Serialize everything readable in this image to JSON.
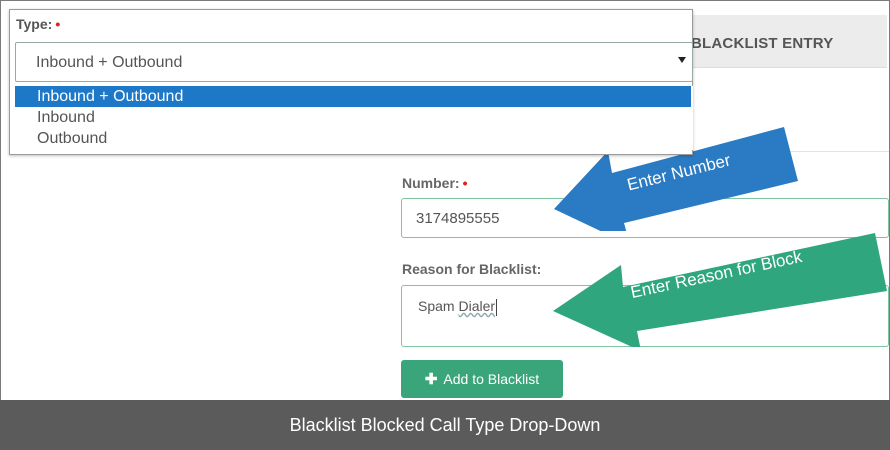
{
  "panel": {
    "header_title": "BLACKLIST ENTRY"
  },
  "type_field": {
    "label": "Type:",
    "required_marker": "•",
    "selected": "Inbound + Outbound",
    "options": [
      "Inbound + Outbound",
      "Inbound",
      "Outbound"
    ]
  },
  "number_field": {
    "label": "Number:",
    "required_marker": "•",
    "value": "3174895555"
  },
  "reason_field": {
    "label": "Reason for Blacklist:",
    "value_part1": "Spam ",
    "value_part2": "Dialer"
  },
  "add_button": {
    "icon": "plus-icon",
    "label": "Add to Blacklist"
  },
  "annotations": {
    "arrow_number": "Enter Number",
    "arrow_reason": "Enter Reason for Block"
  },
  "caption": "Blacklist Blocked Call Type Drop-Down",
  "colors": {
    "accent_green": "#3aa57a",
    "arrow_blue": "#2a7bc3",
    "arrow_green": "#2fa67e",
    "selected_option": "#1e78c8"
  }
}
